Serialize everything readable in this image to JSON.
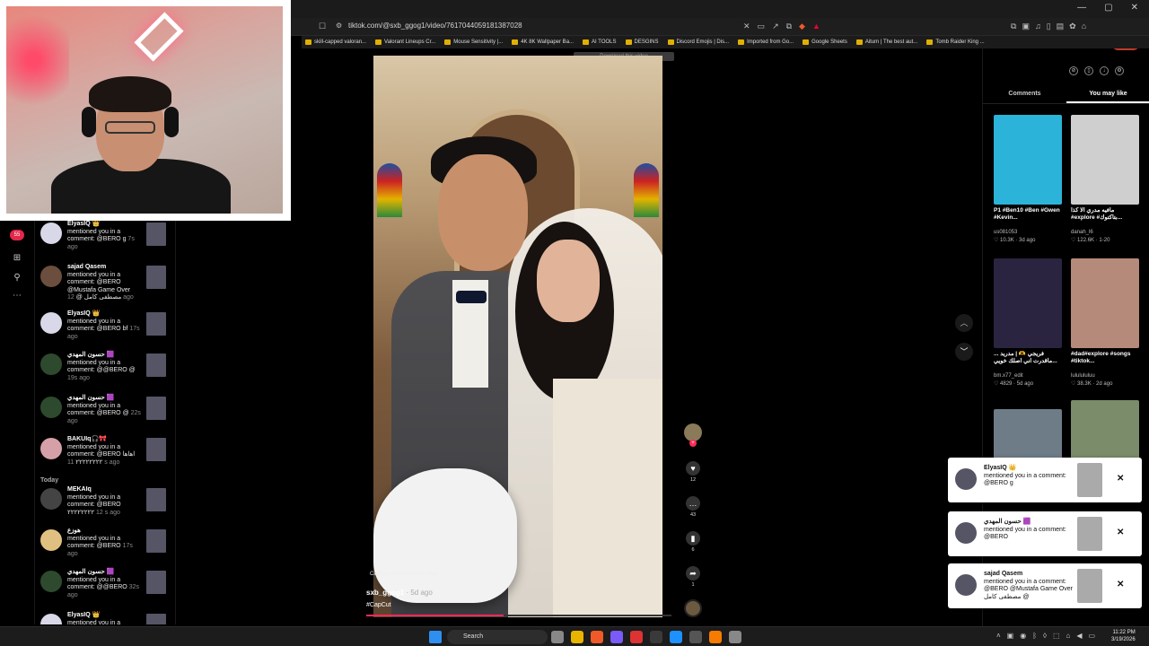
{
  "browser": {
    "url": "tiktok.com/@sxb_ggog1/video/7617044059181387028",
    "update_label": "Update",
    "bookmarks": [
      "skill-capped valoran...",
      "Valorant Lineups Cr...",
      "Mouse Sensitivity |...",
      "4K 8K Wallpaper Ba...",
      "AI TOOLS",
      "DESGINS",
      "Discord Emojis | Dis...",
      "Imported from Go...",
      "Google Sheets",
      "Aitum | The best aut...",
      "Tomb Raider King ..."
    ]
  },
  "sidebar": {
    "badge": "55",
    "today_label": "Today",
    "notifications": [
      {
        "name": "ElyasIQ 👑",
        "text": "mentioned you in a comment: @BERO g",
        "time": "7s ago"
      },
      {
        "name": "sajad Qasem",
        "text": "mentioned you in a comment: @BERO @Mustafa Game Over مصطفى كامل @",
        "time": "12 ago"
      },
      {
        "name": "ElyasIQ 👑",
        "text": "mentioned you in a comment: @BERO bf",
        "time": "17s ago"
      },
      {
        "name": "حسون المهدي 🟪",
        "text": "mentioned you in a comment: @@BERO @",
        "time": "19s ago"
      },
      {
        "name": "حسون المهدي 🟪",
        "text": "mentioned you in a comment: @BERO @",
        "time": "22s ago"
      },
      {
        "name": "BAKUIq🎧🎀",
        "text": "mentioned you in a comment: @BERO اهاها ٢٢٢٢٢٢٢٢",
        "time": "11 s ago"
      },
      {
        "name": "MEKAIq",
        "text": "mentioned you in a comment: @BERO ٢٢٢٢٢٢٢٢",
        "time": "12 s ago"
      },
      {
        "name": "هوزع",
        "text": "mentioned you in a comment: @BERO",
        "time": "17s ago"
      },
      {
        "name": "حسون المهدي 🟪",
        "text": "mentioned you in a comment: @@BERO",
        "time": "32s ago"
      },
      {
        "name": "ElyasIQ 👑",
        "text": "mentioned you in a",
        "time": ""
      }
    ]
  },
  "video": {
    "download_banner": "Download this video",
    "capcut_label": "CapCut · Editing made easy",
    "author": "sxb_ggog1",
    "author_time": "· 5d ago",
    "hashtag": "#CapCut",
    "progress": 0.45,
    "actions": {
      "likes": "12",
      "comments": "43",
      "saves": "6",
      "shares": "1"
    }
  },
  "right_panel": {
    "tabs": {
      "comments": "Comments",
      "you_may_like": "You may like"
    },
    "cards": [
      {
        "desc": "P1 #Ben10 #Ben #Gwen #Kevin...",
        "user": "us081053",
        "meta": "♡ 10.3K · 3d ago",
        "color": "#2bb3d9"
      },
      {
        "desc": "مافيه مدري الا كذا #explore #بتاكتوك...",
        "user": "danah_l6",
        "meta": "♡ 122.6K · 1-20",
        "color": "#cfcfcf"
      },
      {
        "desc": "فريجي 🫶 | مدريد ... ماقدرت اني اصلك خويي...",
        "user": "bm.x77_edit",
        "meta": "♡ 4829 · 5d ago",
        "color": "#2a2440"
      },
      {
        "desc": "#dad#explore #songs #tiktok...",
        "user": "lululululuu",
        "meta": "♡ 38.3K · 2d ago",
        "color": "#b58a7a"
      },
      {
        "desc": "",
        "user": "",
        "meta": "",
        "color": "#6e7c88"
      },
      {
        "desc": "",
        "user": "",
        "meta": "",
        "color": "#7a8c6a"
      }
    ]
  },
  "toasts": [
    {
      "name": "ElyasIQ 👑",
      "text": "mentioned you in a comment: @BERO g"
    },
    {
      "name": "حسون المهدي 🟪",
      "text": "mentioned you in a comment: @BERO"
    },
    {
      "name": "sajad Qasem",
      "text": "mentioned you in a comment: @BERO @Mustafa Game Over مصطفى كامل @"
    }
  ],
  "taskbar": {
    "search_placeholder": "Search",
    "time": "11:22 PM",
    "date": "3/19/2026"
  }
}
